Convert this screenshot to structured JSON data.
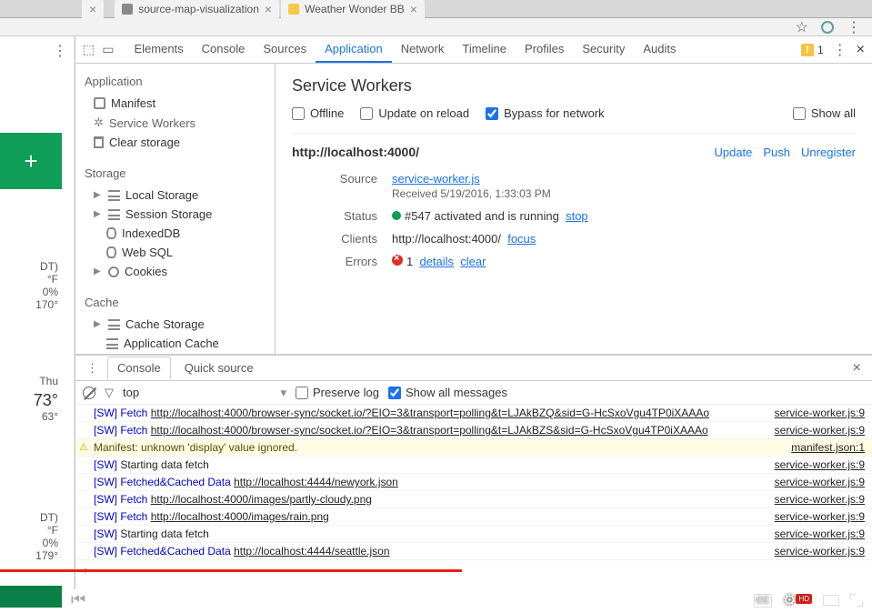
{
  "browser_tabs": [
    {
      "title": "source-map-visualization",
      "active": false
    },
    {
      "title": "Weather Wonder BB",
      "active": true
    }
  ],
  "devtools": {
    "tabs": [
      "Elements",
      "Console",
      "Sources",
      "Application",
      "Network",
      "Timeline",
      "Profiles",
      "Security",
      "Audits"
    ],
    "active_tab": "Application",
    "warnings_count": "1"
  },
  "app_sidebar": {
    "sections": {
      "application": {
        "title": "Application",
        "items": [
          "Manifest",
          "Service Workers",
          "Clear storage"
        ]
      },
      "storage": {
        "title": "Storage",
        "items": [
          "Local Storage",
          "Session Storage",
          "IndexedDB",
          "Web SQL",
          "Cookies"
        ]
      },
      "cache": {
        "title": "Cache",
        "items": [
          "Cache Storage",
          "Application Cache"
        ]
      }
    }
  },
  "service_workers": {
    "heading": "Service Workers",
    "checks": {
      "offline": "Offline",
      "update": "Update on reload",
      "bypass": "Bypass for network",
      "showall": "Show all"
    },
    "entry": {
      "scope": "http://localhost:4000/",
      "actions": {
        "update": "Update",
        "push": "Push",
        "unregister": "Unregister"
      },
      "source_label": "Source",
      "source_link": "service-worker.js",
      "received": "Received 5/19/2016, 1:33:03 PM",
      "status_label": "Status",
      "status_text": "#547 activated and is running",
      "status_stop": "stop",
      "clients_label": "Clients",
      "clients_url": "http://localhost:4000/",
      "clients_focus": "focus",
      "errors_label": "Errors",
      "errors_count": "1",
      "errors_details": "details",
      "errors_clear": "clear"
    }
  },
  "console_drawer": {
    "tabs": [
      "Console",
      "Quick source"
    ],
    "active": "Console",
    "context": "top",
    "preserve_log": "Preserve log",
    "show_all": "Show all messages",
    "logs": [
      {
        "type": "log",
        "prefix": "[SW] Fetch ",
        "url": "http://localhost:4000/browser-sync/socket.io/?EIO=3&transport=polling&t=LJAkBZQ&sid=G-HcSxoVgu4TP0iXAAAo",
        "src": "service-worker.js:9"
      },
      {
        "type": "log",
        "prefix": "[SW] Fetch ",
        "url": "http://localhost:4000/browser-sync/socket.io/?EIO=3&transport=polling&t=LJAkBZS&sid=G-HcSxoVgu4TP0iXAAAo",
        "src": "service-worker.js:9"
      },
      {
        "type": "warn",
        "prefix": "",
        "url": "",
        "text": "Manifest: unknown 'display' value ignored.",
        "src": "manifest.json:1"
      },
      {
        "type": "log",
        "prefix": "[SW] ",
        "text": "Starting data fetch",
        "src": "service-worker.js:9"
      },
      {
        "type": "log",
        "prefix": "[SW] Fetched&Cached Data ",
        "url": "http://localhost:4444/newyork.json",
        "src": "service-worker.js:9"
      },
      {
        "type": "log",
        "prefix": "[SW] Fetch ",
        "url": "http://localhost:4000/images/partly-cloudy.png",
        "src": "service-worker.js:9"
      },
      {
        "type": "log",
        "prefix": "[SW] Fetch ",
        "url": "http://localhost:4000/images/rain.png",
        "src": "service-worker.js:9"
      },
      {
        "type": "log",
        "prefix": "[SW] ",
        "text": "Starting data fetch",
        "src": "service-worker.js:9"
      },
      {
        "type": "log",
        "prefix": "[SW] Fetched&Cached Data ",
        "url": "http://localhost:4444/seattle.json",
        "src": "service-worker.js:9"
      }
    ]
  },
  "weather": {
    "block1": {
      "l1": "DT)",
      "l2": "°F",
      "l3": "0%",
      "l4": "170°"
    },
    "block2": {
      "day": "Thu",
      "hi": "73°",
      "lo": "63°"
    },
    "block3": {
      "l1": "DT)",
      "l2": "°F",
      "l3": "0%",
      "l4": "179°"
    }
  }
}
